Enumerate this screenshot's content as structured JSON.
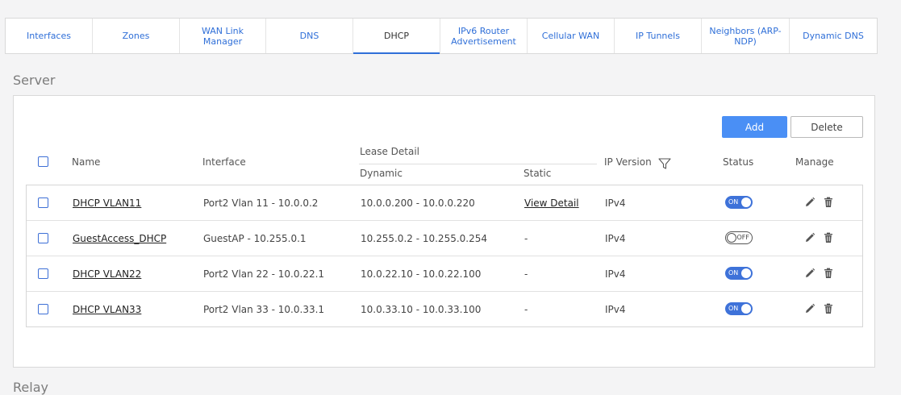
{
  "tabs": [
    {
      "label": "Interfaces",
      "active": false
    },
    {
      "label": "Zones",
      "active": false
    },
    {
      "label": "WAN Link Manager",
      "active": false
    },
    {
      "label": "DNS",
      "active": false
    },
    {
      "label": "DHCP",
      "active": true
    },
    {
      "label": "IPv6 Router Advertisement",
      "active": false
    },
    {
      "label": "Cellular WAN",
      "active": false
    },
    {
      "label": "IP Tunnels",
      "active": false
    },
    {
      "label": "Neighbors (ARP-NDP)",
      "active": false
    },
    {
      "label": "Dynamic DNS",
      "active": false
    }
  ],
  "server": {
    "title": "Server",
    "add_label": "Add",
    "delete_label": "Delete",
    "headers": {
      "name": "Name",
      "interface": "Interface",
      "lease_detail": "Lease Detail",
      "dynamic": "Dynamic",
      "static": "Static",
      "ip_version": "IP Version",
      "status": "Status",
      "manage": "Manage"
    },
    "rows": [
      {
        "name": "DHCP VLAN11",
        "interface": "Port2 Vlan 11 - 10.0.0.2",
        "dynamic": "10.0.0.200 - 10.0.0.220",
        "static": "View Detail",
        "static_link": true,
        "ip_version": "IPv4",
        "status": "ON"
      },
      {
        "name": "GuestAccess_DHCP",
        "interface": "GuestAP - 10.255.0.1",
        "dynamic": "10.255.0.2 - 10.255.0.254",
        "static": "-",
        "static_link": false,
        "ip_version": "IPv4",
        "status": "OFF"
      },
      {
        "name": "DHCP VLAN22",
        "interface": "Port2 Vlan 22 - 10.0.22.1",
        "dynamic": "10.0.22.10 - 10.0.22.100",
        "static": "-",
        "static_link": false,
        "ip_version": "IPv4",
        "status": "ON"
      },
      {
        "name": "DHCP VLAN33",
        "interface": "Port2 Vlan 33 - 10.0.33.1",
        "dynamic": "10.0.33.10 - 10.0.33.100",
        "static": "-",
        "static_link": false,
        "ip_version": "IPv4",
        "status": "ON"
      }
    ]
  },
  "relay": {
    "title": "Relay"
  },
  "colors": {
    "accent": "#2f6fd8",
    "add_button": "#4a8ff5",
    "toggle_on": "#3e72d9"
  },
  "icons": {
    "filter": "filter-icon",
    "edit": "pencil-icon",
    "delete": "trash-icon"
  }
}
